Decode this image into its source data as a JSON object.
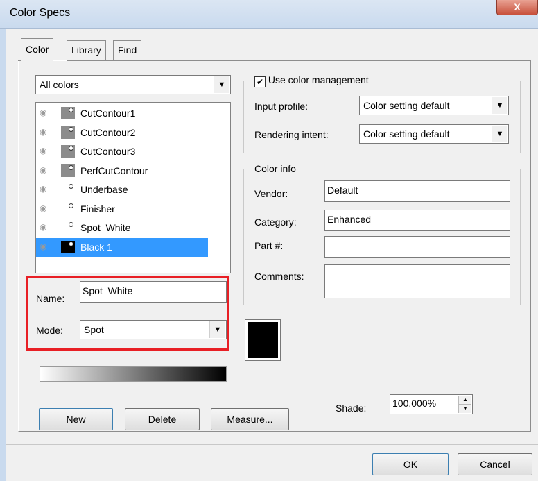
{
  "window": {
    "title": "Color Specs",
    "close_glyph": "X"
  },
  "tabs": [
    {
      "label": "Color"
    },
    {
      "label": "Library"
    },
    {
      "label": "Find"
    }
  ],
  "filter": {
    "value": "All colors"
  },
  "colors": [
    {
      "name": "CutContour1",
      "swatch": "#8c8c8c"
    },
    {
      "name": "CutContour2",
      "swatch": "#8c8c8c"
    },
    {
      "name": "CutContour3",
      "swatch": "#8c8c8c"
    },
    {
      "name": "PerfCutContour",
      "swatch": "#8c8c8c"
    },
    {
      "name": "Underbase",
      "swatch": "#ffffff"
    },
    {
      "name": "Finisher",
      "swatch": "#ffffff"
    },
    {
      "name": "Spot_White",
      "swatch": "#ffffff"
    },
    {
      "name": "Black 1",
      "swatch": "#000000",
      "selected": true
    }
  ],
  "name_field": {
    "label": "Name:",
    "value": "Spot_White"
  },
  "mode_field": {
    "label": "Mode:",
    "value": "Spot"
  },
  "color_management": {
    "checkbox_label": "Use color management",
    "checked": true,
    "input_profile_label": "Input profile:",
    "input_profile_value": "Color setting default",
    "rendering_intent_label": "Rendering intent:",
    "rendering_intent_value": "Color setting default"
  },
  "color_info": {
    "title": "Color info",
    "vendor_label": "Vendor:",
    "vendor_value": "Default",
    "category_label": "Category:",
    "category_value": "Enhanced",
    "part_label": "Part #:",
    "part_value": "",
    "comments_label": "Comments:",
    "comments_value": ""
  },
  "preview_color": "#000000",
  "shade": {
    "label": "Shade:",
    "value": "100.000%"
  },
  "buttons": {
    "new": "New",
    "delete": "Delete",
    "measure": "Measure...",
    "ok": "OK",
    "cancel": "Cancel"
  }
}
